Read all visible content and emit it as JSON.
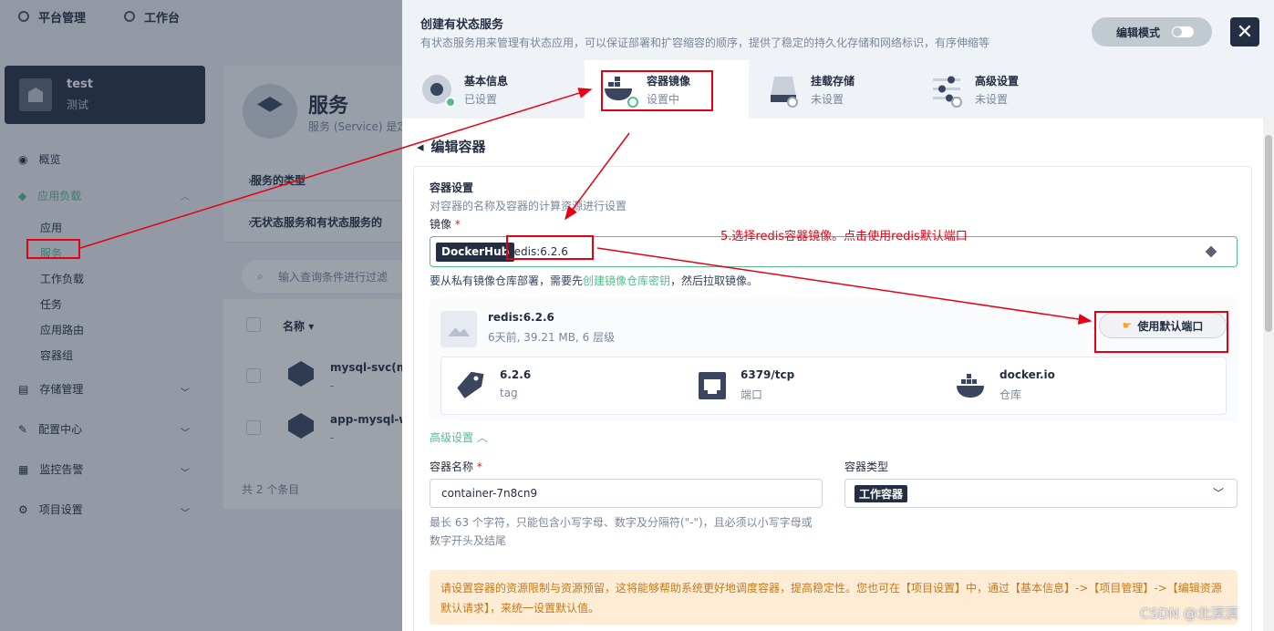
{
  "topnav": {
    "platform": "平台管理",
    "workbench": "工作台"
  },
  "project": {
    "name": "test",
    "desc": "测试"
  },
  "sidebar": {
    "overview": "概览",
    "app_workloads": "应用负载",
    "app_sub": [
      "应用",
      "服务",
      "工作负载",
      "任务",
      "应用路由",
      "容器组"
    ],
    "storage": "存储管理",
    "config": "配置中心",
    "monitor": "监控告警",
    "project_settings": "项目设置"
  },
  "services_page": {
    "title": "服务",
    "desc": "服务 (Service) 是定",
    "types_row": "服务的类型",
    "stateless_row": "无状态服务和有状态服务的",
    "filter_placeholder": "输入查询条件进行过滤",
    "col_name": "名称",
    "rows": [
      {
        "name": "mysql-svc(mys",
        "sub": "-"
      },
      {
        "name": "app-mysql-wyu",
        "sub": "-"
      }
    ],
    "total": "共 2 个条目"
  },
  "modal": {
    "title": "创建有状态服务",
    "desc": "有状态服务用来管理有状态应用，可以保证部署和扩容缩容的顺序，提供了稳定的持久化存储和网络标识，有序伸缩等",
    "edit_mode": "编辑模式",
    "close": "✕",
    "steps": [
      {
        "label": "基本信息",
        "status": "已设置"
      },
      {
        "label": "容器镜像",
        "status": "设置中"
      },
      {
        "label": "挂载存储",
        "status": "未设置"
      },
      {
        "label": "高级设置",
        "status": "未设置"
      }
    ],
    "back_title": "编辑容器",
    "container_settings": "容器设置",
    "container_settings_desc": "对容器的名称及容器的计算资源进行设置",
    "image_label": "镜像",
    "required_mark": "*",
    "registry_tag": "DockerHub",
    "image_value": "redis:6.2.6",
    "hint_prefix": "要从私有镜像仓库部署，需要先",
    "hint_link": "创建镜像仓库密钥",
    "hint_suffix": "，然后拉取镜像。",
    "image_info": {
      "name": "redis:6.2.6",
      "meta": "6天前, 39.21 MB, 6 层级",
      "use_default_port": "使用默认端口",
      "tag_value": "6.2.6",
      "tag_label": "tag",
      "port_value": "6379/tcp",
      "port_label": "端口",
      "repo_value": "docker.io",
      "repo_label": "仓库"
    },
    "advanced": "高级设置",
    "container_name_label": "容器名称",
    "container_name_value": "container-7n8cn9",
    "container_name_hint": "最长 63 个字符，只能包含小写字母、数字及分隔符(\"-\")，且必须以小写字母或数字开头及结尾",
    "container_type_label": "容器类型",
    "container_type_value": "工作容器",
    "warning": "请设置容器的资源限制与资源预留，这将能够帮助系统更好地调度容器，提高稳定性。您也可在【项目设置】中，通过【基本信息】->【项目管理】->【编辑资源默认请求】，来统一设置默认值。"
  },
  "annotation": "5.选择redis容器镜像。点击使用redis默认端口",
  "watermark": "CSDN @北溟溟",
  "colors": {
    "accent": "#55bc8a",
    "dark": "#242e42",
    "annotation_red": "#e60012",
    "warning_bg": "#ffecd4"
  }
}
